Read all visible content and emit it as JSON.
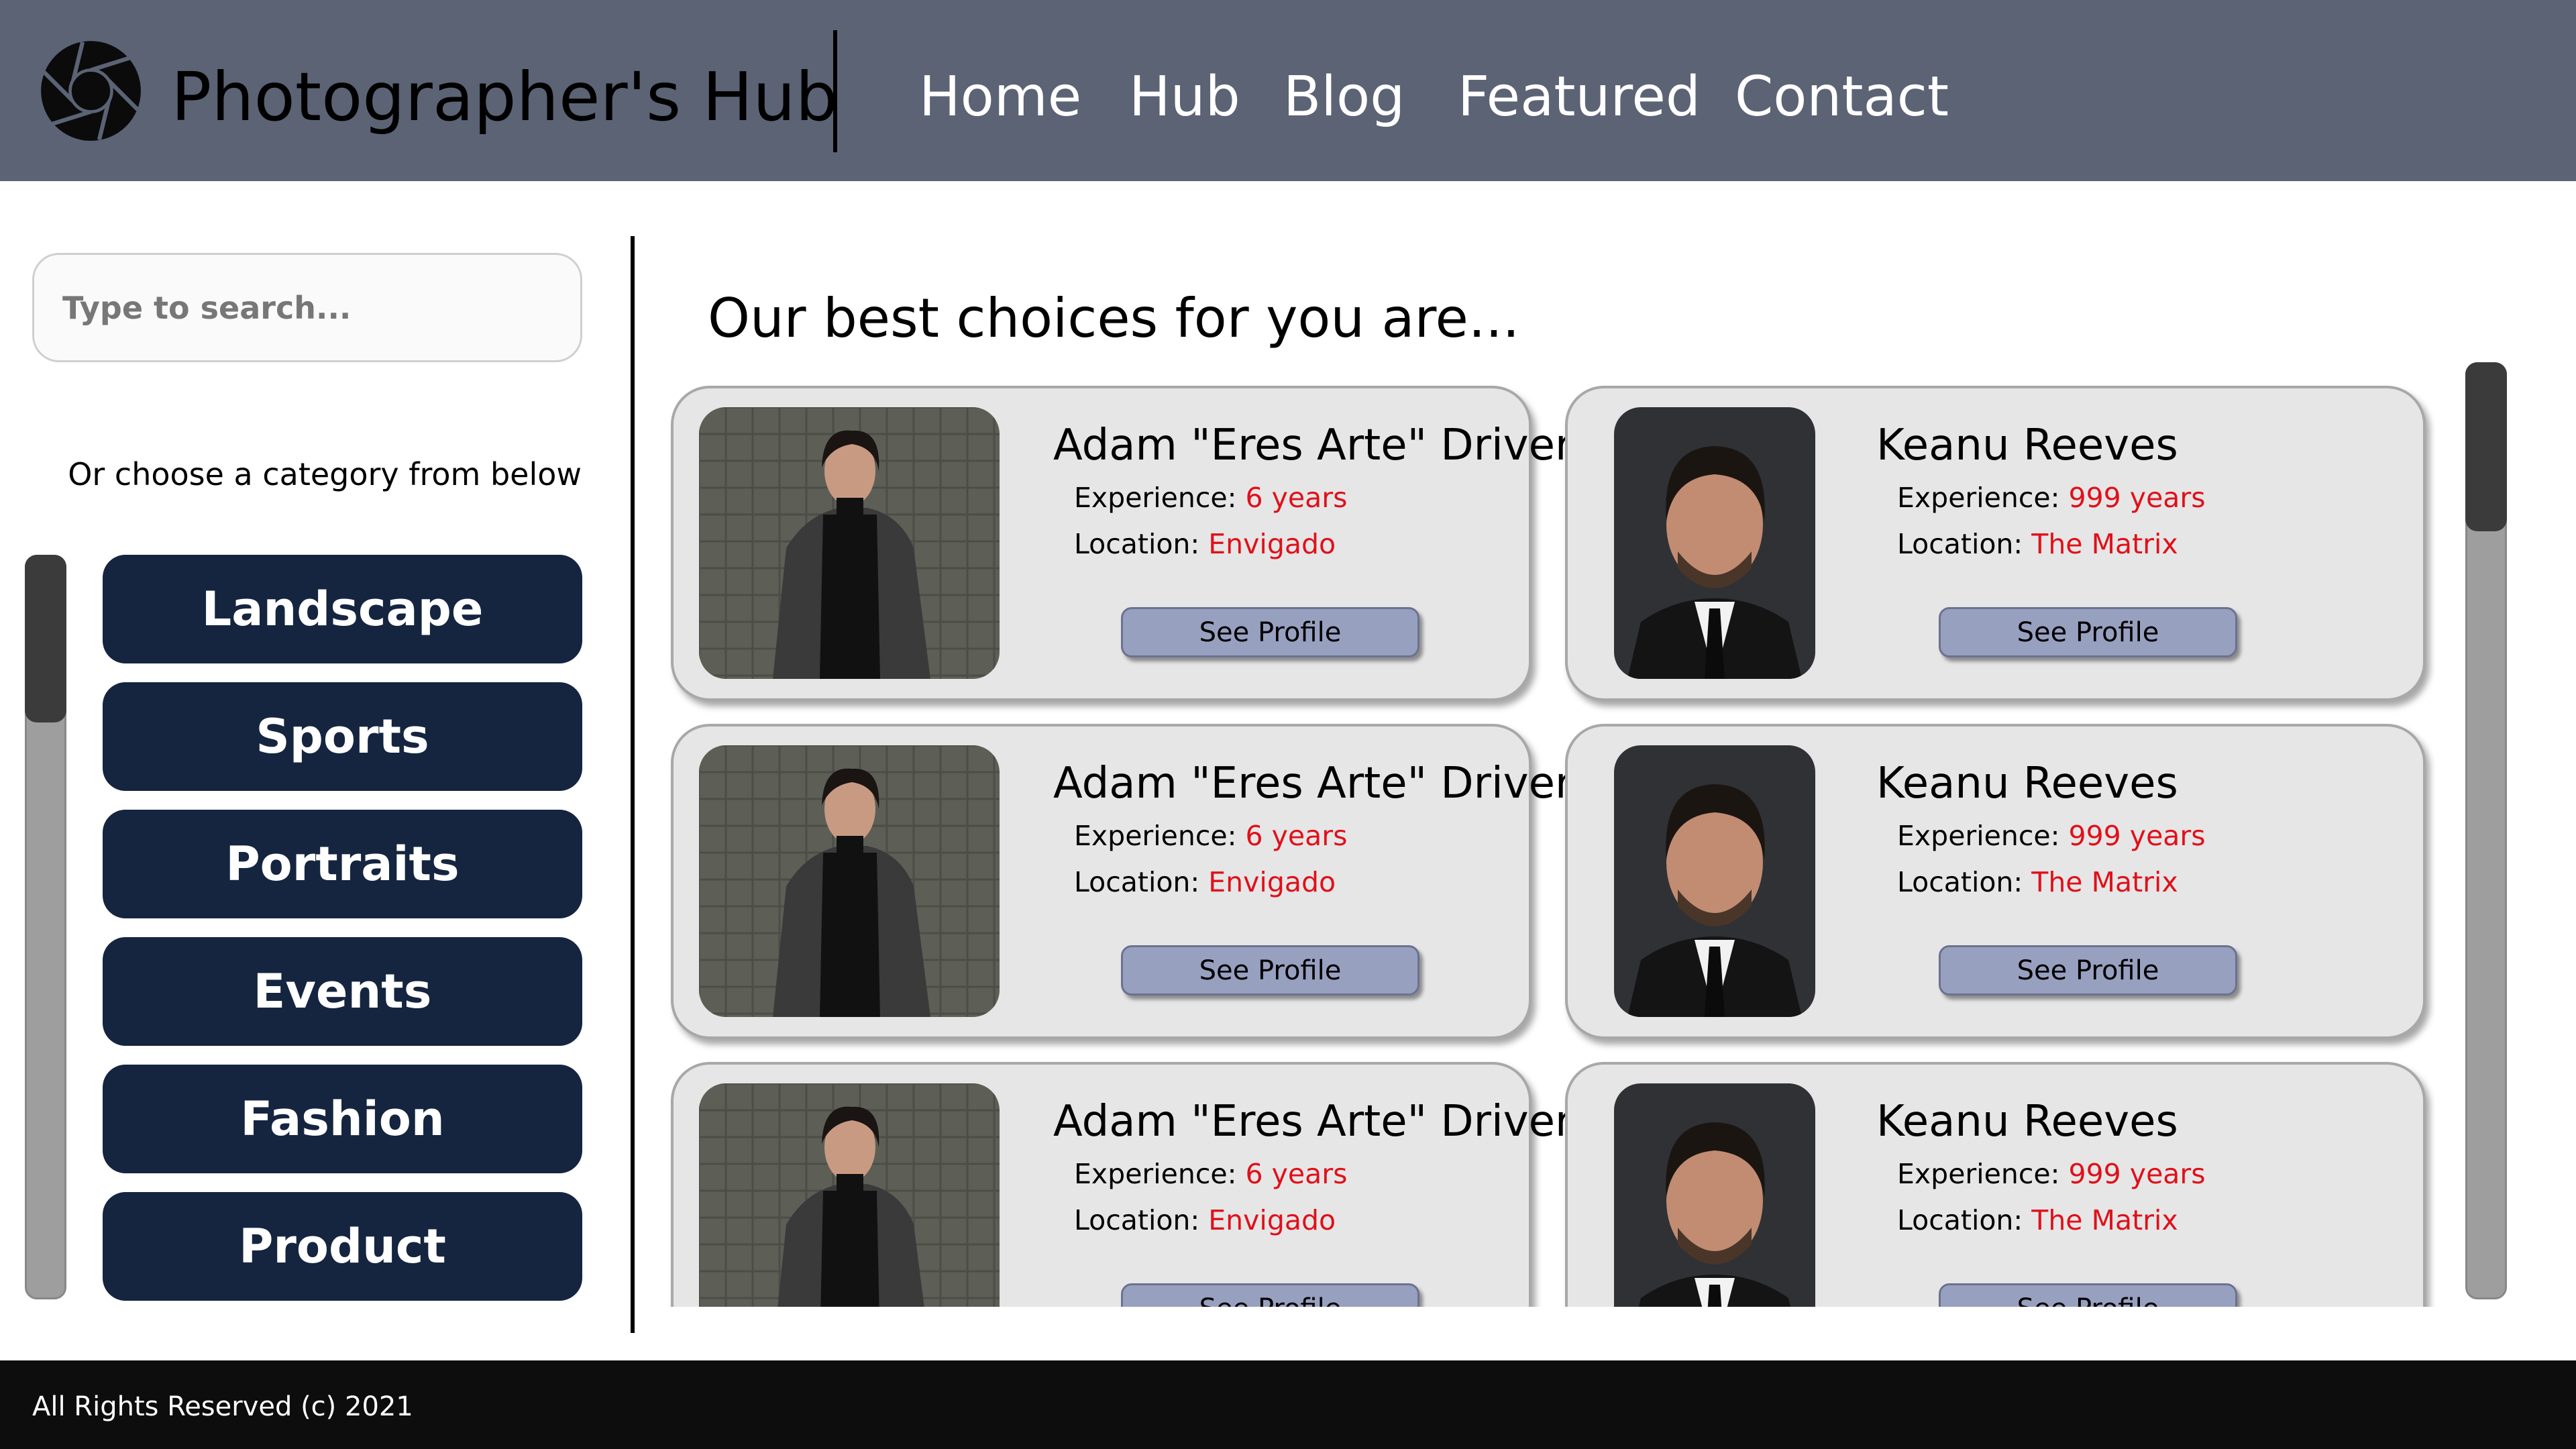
{
  "brand": {
    "name": "Photographer's Hub",
    "logo_icon": "camera-aperture-icon"
  },
  "nav": [
    {
      "label": "Home"
    },
    {
      "label": "Hub"
    },
    {
      "label": "Blog"
    },
    {
      "label": "Featured"
    },
    {
      "label": "Contact"
    }
  ],
  "sidebar": {
    "search_placeholder": "Type to search...",
    "category_hint": "Or choose a category from below",
    "categories": [
      {
        "label": "Landscape"
      },
      {
        "label": "Sports"
      },
      {
        "label": "Portraits"
      },
      {
        "label": "Events"
      },
      {
        "label": "Fashion"
      },
      {
        "label": "Product"
      }
    ]
  },
  "main": {
    "heading": "Our best choices for you are...",
    "cards": [
      {
        "name": "Adam \"Eres Arte\" Driver",
        "experience_label": "Experience:",
        "experience": "6 years",
        "location_label": "Location:",
        "location": "Envigado",
        "button": "See Profile"
      },
      {
        "name": "Keanu Reeves",
        "experience_label": "Experience:",
        "experience": "999 years",
        "location_label": "Location:",
        "location": "The Matrix",
        "button": "See Profile"
      },
      {
        "name": "Adam \"Eres Arte\" Driver",
        "experience_label": "Experience:",
        "experience": "6 years",
        "location_label": "Location:",
        "location": "Envigado",
        "button": "See Profile"
      },
      {
        "name": "Keanu Reeves",
        "experience_label": "Experience:",
        "experience": "999 years",
        "location_label": "Location:",
        "location": "The Matrix",
        "button": "See Profile"
      },
      {
        "name": "Adam \"Eres Arte\" Driver",
        "experience_label": "Experience:",
        "experience": "6 years",
        "location_label": "Location:",
        "location": "Envigado",
        "button": "See Profile"
      },
      {
        "name": "Keanu Reeves",
        "experience_label": "Experience:",
        "experience": "999 years",
        "location_label": "Location:",
        "location": "The Matrix",
        "button": "See Profile"
      }
    ]
  },
  "footer": {
    "text": "All Rights Reserved (c) 2021"
  },
  "colors": {
    "header_bg": "#5b6375",
    "category_button_bg": "#152540",
    "card_bg": "#e6e6e6",
    "profile_button_bg": "#98a0c0",
    "accent_value": "#e0101a",
    "footer_bg": "#0d0d0d"
  }
}
